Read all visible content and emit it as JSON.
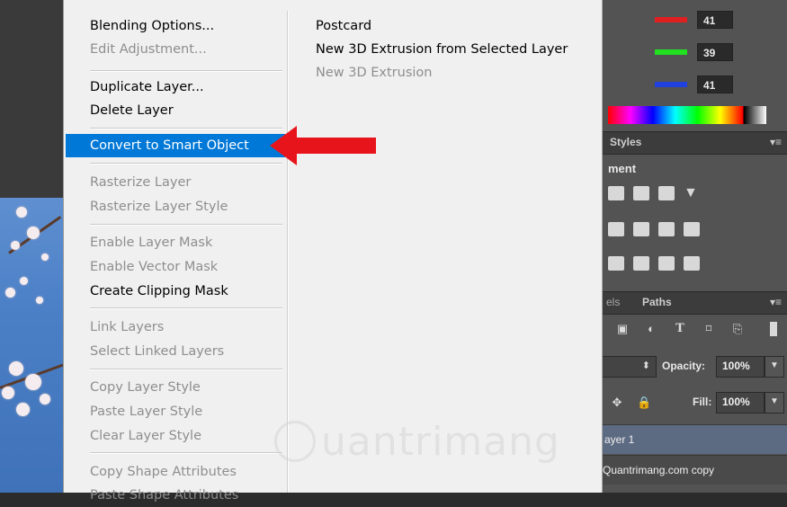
{
  "menu": {
    "items": [
      {
        "label": "Blending Options...",
        "enabled": true
      },
      {
        "label": "Edit Adjustment...",
        "enabled": false
      },
      {
        "label": "Duplicate Layer...",
        "enabled": true
      },
      {
        "label": "Delete Layer",
        "enabled": true
      },
      {
        "label": "Convert to Smart Object",
        "enabled": true,
        "selected": true
      },
      {
        "label": "Rasterize Layer",
        "enabled": false
      },
      {
        "label": "Rasterize Layer Style",
        "enabled": false
      },
      {
        "label": "Enable Layer Mask",
        "enabled": false
      },
      {
        "label": "Enable Vector Mask",
        "enabled": false
      },
      {
        "label": "Create Clipping Mask",
        "enabled": true
      },
      {
        "label": "Link Layers",
        "enabled": false
      },
      {
        "label": "Select Linked Layers",
        "enabled": false
      },
      {
        "label": "Copy Layer Style",
        "enabled": false
      },
      {
        "label": "Paste Layer Style",
        "enabled": false
      },
      {
        "label": "Clear Layer Style",
        "enabled": false
      },
      {
        "label": "Copy Shape Attributes",
        "enabled": false
      },
      {
        "label": "Paste Shape Attributes",
        "enabled": false
      }
    ],
    "submenu": [
      {
        "label": "Postcard",
        "enabled": true
      },
      {
        "label": "New 3D Extrusion from Selected Layer",
        "enabled": true
      },
      {
        "label": "New 3D Extrusion",
        "enabled": false
      }
    ],
    "selected_color": "#0078d7"
  },
  "color_panel": {
    "r": "41",
    "g": "39",
    "b": "41"
  },
  "panels": {
    "styles_tab": "Styles",
    "adjustments_title": "ment",
    "channels_tab": "els",
    "paths_tab": "Paths",
    "opacity_label": "Opacity:",
    "opacity_value": "100%",
    "fill_label": "Fill:",
    "fill_value": "100%",
    "layers": [
      "ayer 1",
      "Quantrimang.com copy"
    ]
  },
  "annotation": {
    "arrow_color": "#e8141b"
  },
  "watermark": {
    "text": "uantrimang"
  },
  "icons": [
    "menu-lines-icon",
    "lock-icon",
    "move-icon",
    "type-tool-icon",
    "red-arrow-icon",
    "bulb-logo-icon"
  ]
}
